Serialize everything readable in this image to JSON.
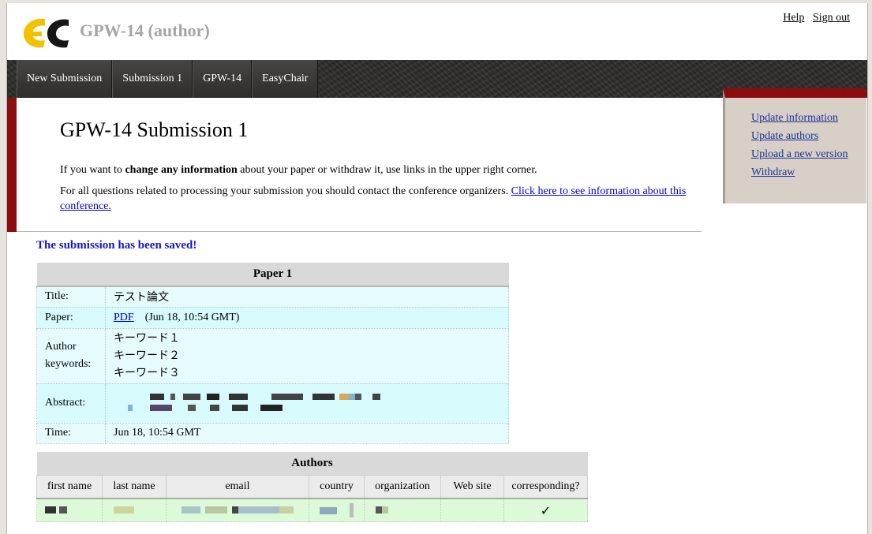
{
  "header": {
    "app_title": "GPW-14 (author)",
    "help_link": "Help",
    "signout_link": "Sign out"
  },
  "nav": {
    "tabs": [
      "New Submission",
      "Submission 1",
      "GPW-14",
      "EasyChair"
    ]
  },
  "main": {
    "heading": "GPW-14 Submission 1",
    "info_line1_prefix": "If you want to ",
    "info_line1_bold": "change any information",
    "info_line1_suffix": " about your paper or withdraw it, use links in the upper right corner.",
    "info_line2_text": "For all questions related to processing your submission you should contact the conference organizers. ",
    "info_line2_link": "Click here to see information about this conference.",
    "saved_message": "The submission has been saved!"
  },
  "sidebar": {
    "links": [
      "Update information",
      "Update authors",
      "Upload a new version",
      "Withdraw"
    ]
  },
  "paper": {
    "caption": "Paper 1",
    "title_label": "Title:",
    "title_value": "テスト論文",
    "paper_label": "Paper:",
    "paper_link": "PDF",
    "paper_date": "(Jun 18, 10:54 GMT)",
    "keywords_label_1": "Author",
    "keywords_label_2": "keywords:",
    "keywords": [
      "キーワード１",
      "キーワード２",
      "キーワード３"
    ],
    "abstract_label": "Abstract:",
    "time_label": "Time:",
    "time_value": "Jun 18, 10:54 GMT"
  },
  "authors": {
    "caption": "Authors",
    "columns": [
      "first name",
      "last name",
      "email",
      "country",
      "organization",
      "Web site",
      "corresponding?"
    ],
    "corresponding_mark": "✓"
  },
  "colors": {
    "accent_red": "#8b0d0d",
    "link_blue": "#0000cc",
    "saved_blue": "#1515c8",
    "paper_row": "#e5fbfc",
    "author_row": "#dcf9d8",
    "sidebar_bg": "#d8d0c7"
  },
  "icons": {
    "logo": "easychair-logo",
    "check": "checkmark-icon"
  }
}
